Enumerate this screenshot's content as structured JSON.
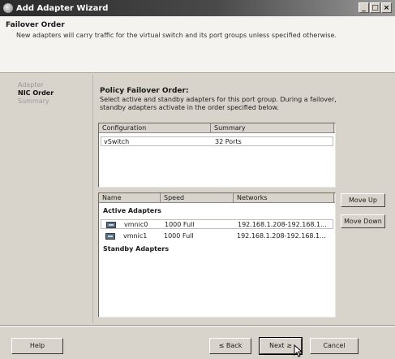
{
  "window": {
    "title": "Add Adapter Wizard",
    "buttons": [
      "_",
      "□",
      "×"
    ]
  },
  "header": {
    "title": "Failover Order",
    "subtitle": "New adapters will carry traffic for the virtual switch and its port groups unless specified otherwise."
  },
  "steps": [
    {
      "label": "Adapter",
      "active": false
    },
    {
      "label": "NIC Order",
      "active": true
    },
    {
      "label": "Summary",
      "active": false
    }
  ],
  "content": {
    "title": "Policy Failover Order:",
    "description": "Select active and standby adapters for this port group. During a failover, standby adapters activate in the order specified below."
  },
  "switch_table": {
    "columns": [
      "Configuration",
      "Summary"
    ],
    "rows": [
      {
        "configuration": "vSwitch",
        "summary": "32 Ports"
      }
    ]
  },
  "adapter_table": {
    "columns": [
      "Name",
      "Speed",
      "Networks"
    ],
    "active_label": "Active Adapters",
    "standby_label": "Standby Adapters",
    "active": [
      {
        "name": "vmnic0",
        "speed": "1000 Full",
        "networks": "192.168.1.208-192.168.1..."
      },
      {
        "name": "vmnic1",
        "speed": "1000 Full",
        "networks": "192.168.1.208-192.168.1..."
      }
    ]
  },
  "side_buttons": {
    "move_up": "Move Up",
    "move_down": "Move Down"
  },
  "footer": {
    "help": "Help",
    "back": "≤ Back",
    "next": "Next ≥",
    "cancel": "Cancel"
  }
}
